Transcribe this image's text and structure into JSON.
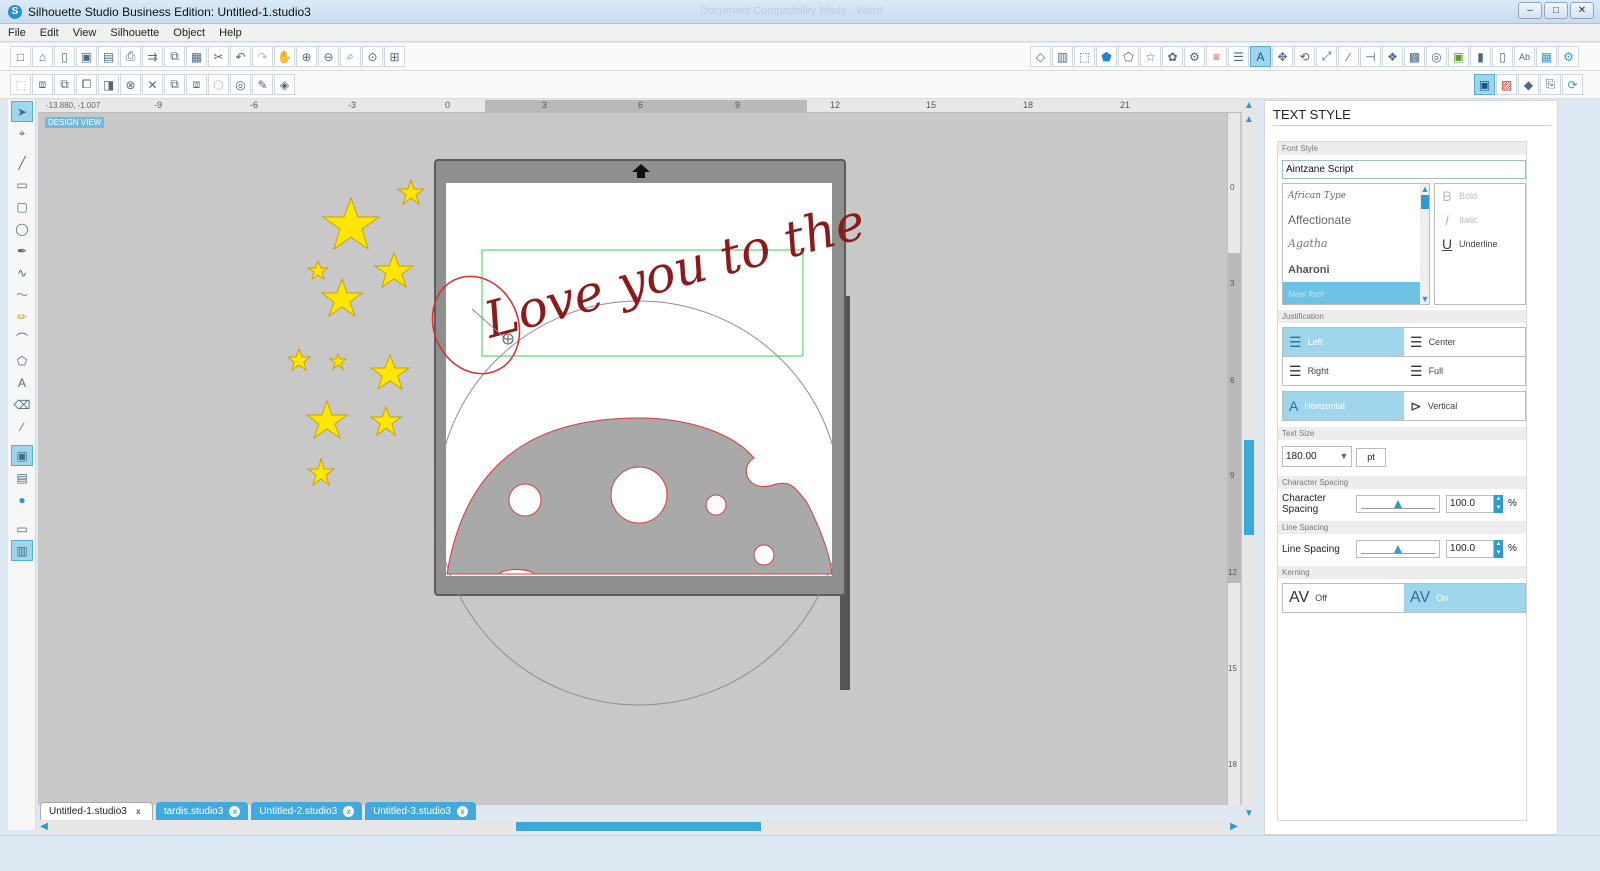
{
  "window": {
    "title": "Silhouette Studio Business Edition: Untitled-1.studio3",
    "ghost_title": "Document Compatibility Mode - Word",
    "buttons": [
      "–",
      "□",
      "✕"
    ]
  },
  "menu": [
    "File",
    "Edit",
    "View",
    "Silhouette",
    "Object",
    "Help"
  ],
  "toolbar1_left": [
    "new-page",
    "open",
    "new-doc",
    "save",
    "save-as",
    "print",
    "send",
    "copy",
    "paste",
    "cut",
    "undo",
    "redo",
    "pan",
    "zoom-in",
    "zoom-out",
    "zoom-select",
    "zoom-drag",
    "fit-page"
  ],
  "toolbar1_right": [
    "page-setup",
    "grid",
    "registration",
    "fill",
    "pentagon",
    "star",
    "flower",
    "gear",
    "line-color",
    "line-style",
    "text-style",
    "transform",
    "rotate",
    "scale",
    "pen",
    "align",
    "replicate",
    "nest",
    "offset",
    "trace",
    "library",
    "cut-settings",
    "ab-text",
    "ruler-grid",
    "settings"
  ],
  "toolbar2_left": [
    "group",
    "ungroup",
    "compound",
    "release",
    "bring-front",
    "weld",
    "delete",
    "order-front",
    "order-back",
    "send-front",
    "modify",
    "offset-circle",
    "eyedropper",
    "fill-shade"
  ],
  "toolbar2_right": [
    "select-mode",
    "pixscan",
    "eraser",
    "send-silhouette",
    "refresh"
  ],
  "left_tools": [
    "pointer",
    "edit-points",
    "line",
    "rectangle",
    "rounded-rect",
    "ellipse",
    "pen",
    "curve",
    "freehand",
    "pencil",
    "arc",
    "polygon",
    "text",
    "eraser",
    "knife",
    "design-view",
    "library",
    "store",
    "page-single",
    "page-split"
  ],
  "ruler": {
    "coords": "-13.880, -1.007",
    "ticks": [
      "-9",
      "-6",
      "-3",
      "0",
      "3",
      "6",
      "9",
      "12",
      "15",
      "18",
      "21"
    ],
    "vticks": [
      "0",
      "3",
      "6",
      "9",
      "12",
      "15",
      "18"
    ]
  },
  "design_view_label": "DESIGN VIEW",
  "canvas": {
    "text_art": "Love you to the"
  },
  "tabs": [
    {
      "label": "Untitled-1.studio3",
      "active": true
    },
    {
      "label": "tardis.studio3",
      "active": false
    },
    {
      "label": "Untitled-2.studio3",
      "active": false
    },
    {
      "label": "Untitled-3.studio3",
      "active": false
    }
  ],
  "panel": {
    "title": "TEXT STYLE",
    "font_style_label": "Font Style",
    "font_name": "Aintzane Script",
    "font_list": [
      "African Type",
      "Affectionate",
      "Agatha",
      "Aharoni",
      "New font"
    ],
    "styles": {
      "bold": "Bold",
      "italic": "Italic",
      "underline": "Underline"
    },
    "justification_label": "Justification",
    "justify": {
      "left": "Left",
      "center": "Center",
      "right": "Right",
      "full": "Full"
    },
    "direction": {
      "horizontal": "Horizontal",
      "vertical": "Vertical"
    },
    "text_size_label": "Text Size",
    "text_size": "180.00",
    "text_unit": "pt",
    "char_spacing_section": "Character Spacing",
    "char_spacing_label": "Character Spacing",
    "char_spacing_value": "100.0",
    "line_spacing_section": "Line Spacing",
    "line_spacing_label": "Line Spacing",
    "line_spacing_value": "100.0",
    "percent": "%",
    "kerning_label": "Kerning",
    "kerning": {
      "off": "Off",
      "on": "On"
    }
  },
  "colors": {
    "accent": "#41a9dc",
    "mat": "#8f8f8f",
    "star": "#ffe600",
    "text_art": "#8b1a1a",
    "cut_line": "#d92f2f",
    "selection": "#3bd04b"
  }
}
